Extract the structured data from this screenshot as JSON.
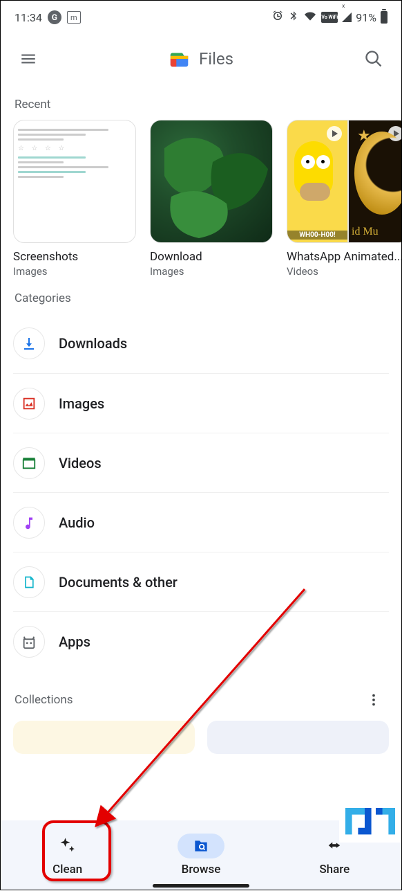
{
  "status": {
    "time": "11:34",
    "battery": "91%",
    "wifi_badge": "Vo WiFi",
    "signal_prefix": "x"
  },
  "header": {
    "title": "Files"
  },
  "sections": {
    "recent": "Recent",
    "categories": "Categories",
    "collections": "Collections"
  },
  "recent": [
    {
      "label": "Screenshots",
      "sub": "Images"
    },
    {
      "label": "Download",
      "sub": "Images"
    },
    {
      "label": "WhatsApp Animated...",
      "sub": "Videos",
      "caption_left": "WH00-H00!",
      "caption_right": "id Mu"
    }
  ],
  "categories": [
    {
      "label": "Downloads"
    },
    {
      "label": "Images"
    },
    {
      "label": "Videos"
    },
    {
      "label": "Audio"
    },
    {
      "label": "Documents & other"
    },
    {
      "label": "Apps"
    }
  ],
  "nav": {
    "clean": "Clean",
    "browse": "Browse",
    "share": "Share"
  }
}
